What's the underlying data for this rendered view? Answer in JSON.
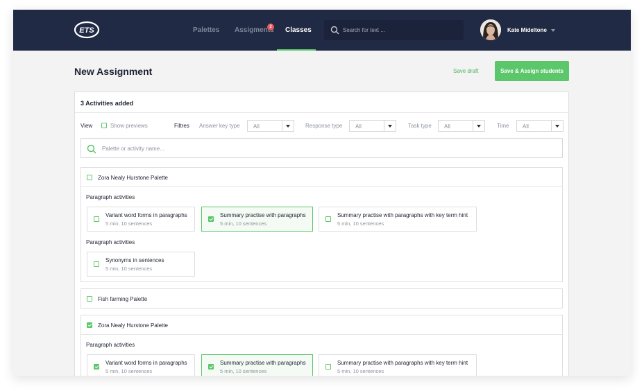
{
  "brand": {
    "logo_text": "ETS"
  },
  "nav": {
    "tabs": [
      {
        "label": "Palettes"
      },
      {
        "label": "Assigments",
        "badge": "2"
      },
      {
        "label": "Classes",
        "active": true
      }
    ],
    "search_placeholder": "Search for text ...",
    "user_name": "Kate Mideltone"
  },
  "page": {
    "title": "New Assignment",
    "save_draft_label": "Save draft",
    "save_assign_label": "Save & Assign students"
  },
  "activities": {
    "count_title": "3 Activities added",
    "view_label": "View",
    "show_previews_label": "Show previews",
    "filters_label": "Filtres",
    "filters": [
      {
        "label": "Answer key type",
        "value": "All"
      },
      {
        "label": "Response type",
        "value": "All"
      },
      {
        "label": "Task type",
        "value": "All"
      },
      {
        "label": "Time",
        "value": "All"
      }
    ],
    "search_placeholder": "Palette or activity name..."
  },
  "palettes": [
    {
      "name": "Zora Nealy Hurstone Palette",
      "checked": false,
      "sections": [
        {
          "label": "Paragraph activities",
          "items": [
            {
              "title": "Variant word forms in paragraphs",
              "meta": "5 min, 10 sentences",
              "checked": false
            },
            {
              "title": "Summary practise with paragraphs",
              "meta": "5 min, 10 sentences",
              "checked": true
            },
            {
              "title": "Summary practise with paragraphs with key term hint",
              "meta": "5 min, 10 sentences",
              "checked": false
            }
          ]
        },
        {
          "label": "Paragraph activities",
          "items": [
            {
              "title": "Synonyms in sentences",
              "meta": "5 min, 10 sentences",
              "checked": false
            }
          ]
        }
      ]
    },
    {
      "name": "Fish farming Palette",
      "checked": false
    },
    {
      "name": "Zora Nealy Hurstone Palette",
      "checked": true,
      "sections": [
        {
          "label": "Paragraph activities",
          "items": [
            {
              "title": "Variant word forms in paragraphs",
              "meta": "5 min, 10 sentences",
              "checked": true
            },
            {
              "title": "Summary practise with paragraphs",
              "meta": "5 min, 10 sentences",
              "checked": true
            },
            {
              "title": "Summary practise with paragraphs with key term hint",
              "meta": "5 min, 10 sentences",
              "checked": false
            }
          ]
        }
      ]
    }
  ],
  "colors": {
    "navbar": "#212a45",
    "accent": "#5cc76a",
    "badge": "#e85a5a",
    "background": "#f3f3f3"
  }
}
